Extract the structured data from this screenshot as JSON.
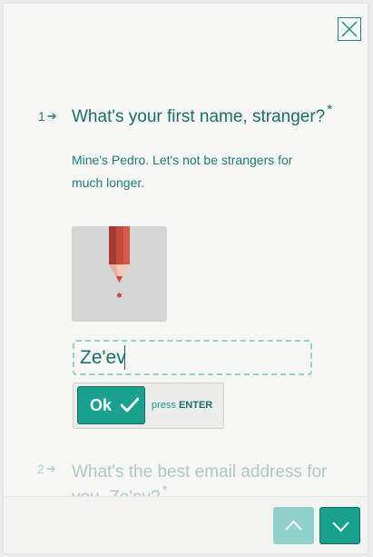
{
  "close": {
    "icon": "close-icon"
  },
  "question1": {
    "number": "1",
    "title": "What's your first name, stranger?",
    "required_mark": "*",
    "description": "Mine's Pedro. Let's not be strangers for much longer.",
    "image_icon": "pencil-icon",
    "answer_value": "Ze'ev",
    "ok_label": "Ok",
    "press_label": "press",
    "press_key": "ENTER"
  },
  "question2": {
    "number": "2",
    "title": "What's the best email address for you, Ze'ev?",
    "required_mark": "*"
  },
  "navigation": {
    "up_icon": "chevron-up-icon",
    "down_icon": "chevron-down-icon"
  },
  "colors": {
    "accent": "#19a08f",
    "text": "#186f6a",
    "light_accent": "#8fd0c9"
  }
}
